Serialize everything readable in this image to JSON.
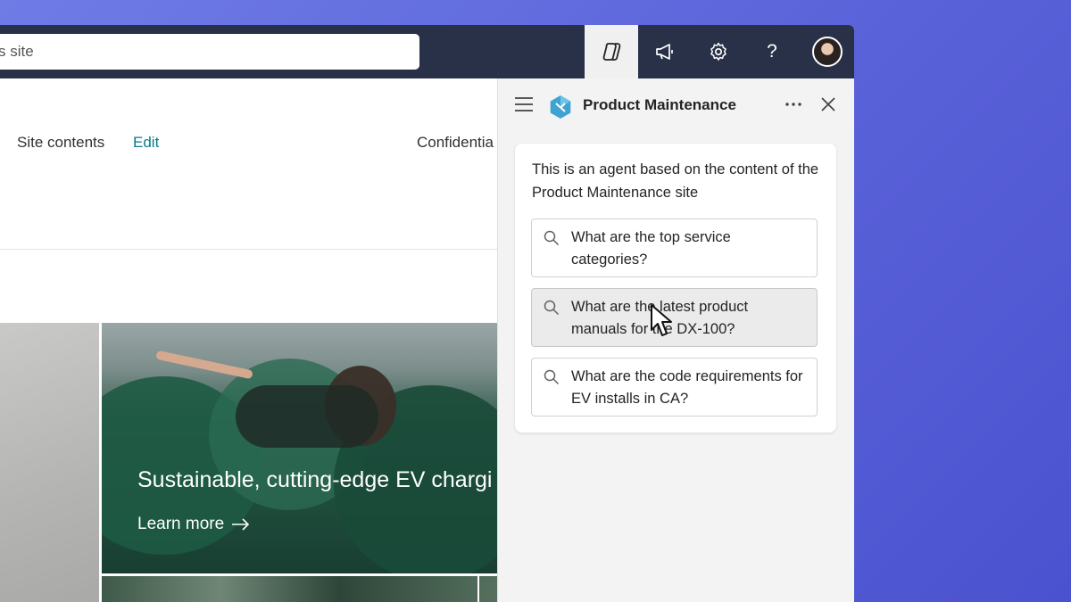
{
  "search": {
    "placeholder": "s site"
  },
  "topbar": {
    "icons": [
      "copilot-icon",
      "megaphone-icon",
      "gear-icon",
      "help-icon",
      "avatar"
    ],
    "help_label": "?"
  },
  "site_nav": {
    "site_contents": "Site contents",
    "edit": "Edit",
    "confidential": "Confidentia"
  },
  "hero": {
    "title": "Sustainable, cutting-edge EV chargi",
    "link": "Learn more"
  },
  "agent_pane": {
    "title": "Product Maintenance",
    "description": "This is an agent based on the content of the Product Maintenance site",
    "suggestions": [
      {
        "text": "What are the top service categories?"
      },
      {
        "text": "What are the latest product manuals for the DX-100?"
      },
      {
        "text": "What are the code requirements for EV installs in CA?"
      }
    ]
  },
  "colors": {
    "background": "#5a62d9",
    "topbar": "#293148",
    "link_teal": "#0b7a86",
    "pane_bg": "#f3f3f3"
  }
}
